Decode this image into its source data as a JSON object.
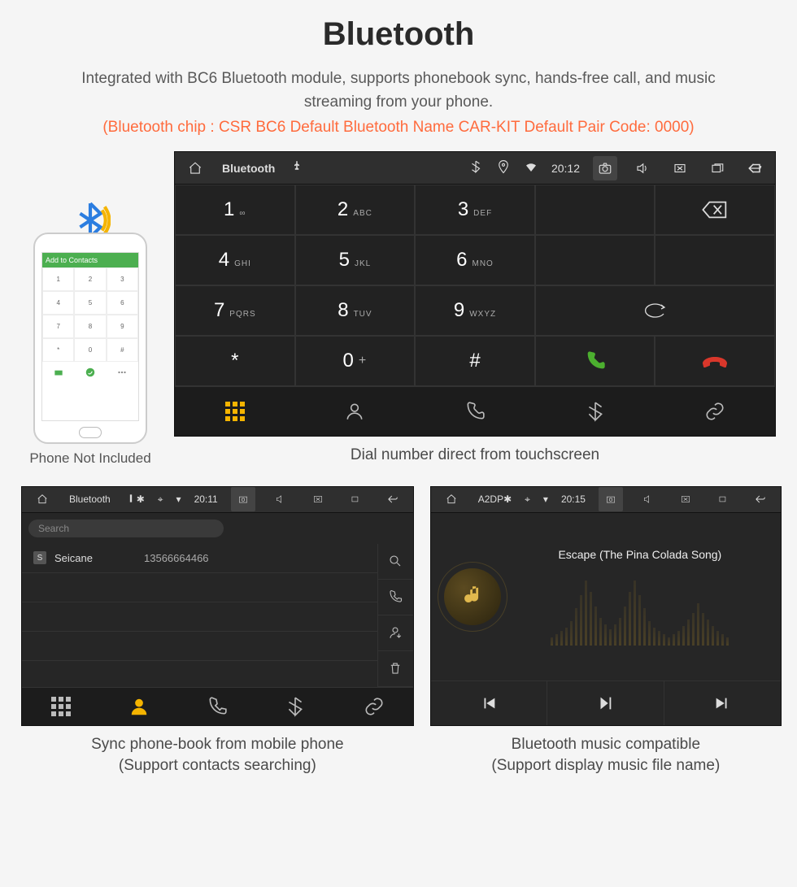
{
  "header": {
    "title": "Bluetooth",
    "subtitle": "Integrated with BC6 Bluetooth module, supports phonebook sync, hands-free call, and music streaming from your phone.",
    "specs": "(Bluetooth chip : CSR BC6    Default Bluetooth Name CAR-KIT    Default Pair Code: 0000)"
  },
  "phone": {
    "caption": "Phone Not Included",
    "top_bar": "Add to Contacts",
    "keys": [
      "1",
      "2",
      "3",
      "4",
      "5",
      "6",
      "7",
      "8",
      "9",
      "*",
      "0",
      "#"
    ]
  },
  "dialer": {
    "status_title": "Bluetooth",
    "status_time": "20:12",
    "caption": "Dial number direct from touchscreen",
    "keys": [
      {
        "n": "1",
        "s": "∞"
      },
      {
        "n": "2",
        "s": "ABC"
      },
      {
        "n": "3",
        "s": "DEF"
      },
      {
        "n": "4",
        "s": "GHI"
      },
      {
        "n": "5",
        "s": "JKL"
      },
      {
        "n": "6",
        "s": "MNO"
      },
      {
        "n": "7",
        "s": "PQRS"
      },
      {
        "n": "8",
        "s": "TUV"
      },
      {
        "n": "9",
        "s": "WXYZ"
      },
      {
        "n": "*",
        "s": ""
      },
      {
        "n": "0",
        "s": "+"
      },
      {
        "n": "#",
        "s": ""
      }
    ]
  },
  "phonebook": {
    "status_title": "Bluetooth",
    "status_time": "20:11",
    "search_placeholder": "Search",
    "contact_name": "Seicane",
    "contact_badge": "S",
    "contact_number": "13566664466",
    "caption_line1": "Sync phone-book from mobile phone",
    "caption_line2": "(Support contacts searching)"
  },
  "music": {
    "status_title": "A2DP",
    "status_time": "20:15",
    "track_title": "Escape (The Pina Colada Song)",
    "caption_line1": "Bluetooth music compatible",
    "caption_line2": "(Support display music file name)"
  }
}
